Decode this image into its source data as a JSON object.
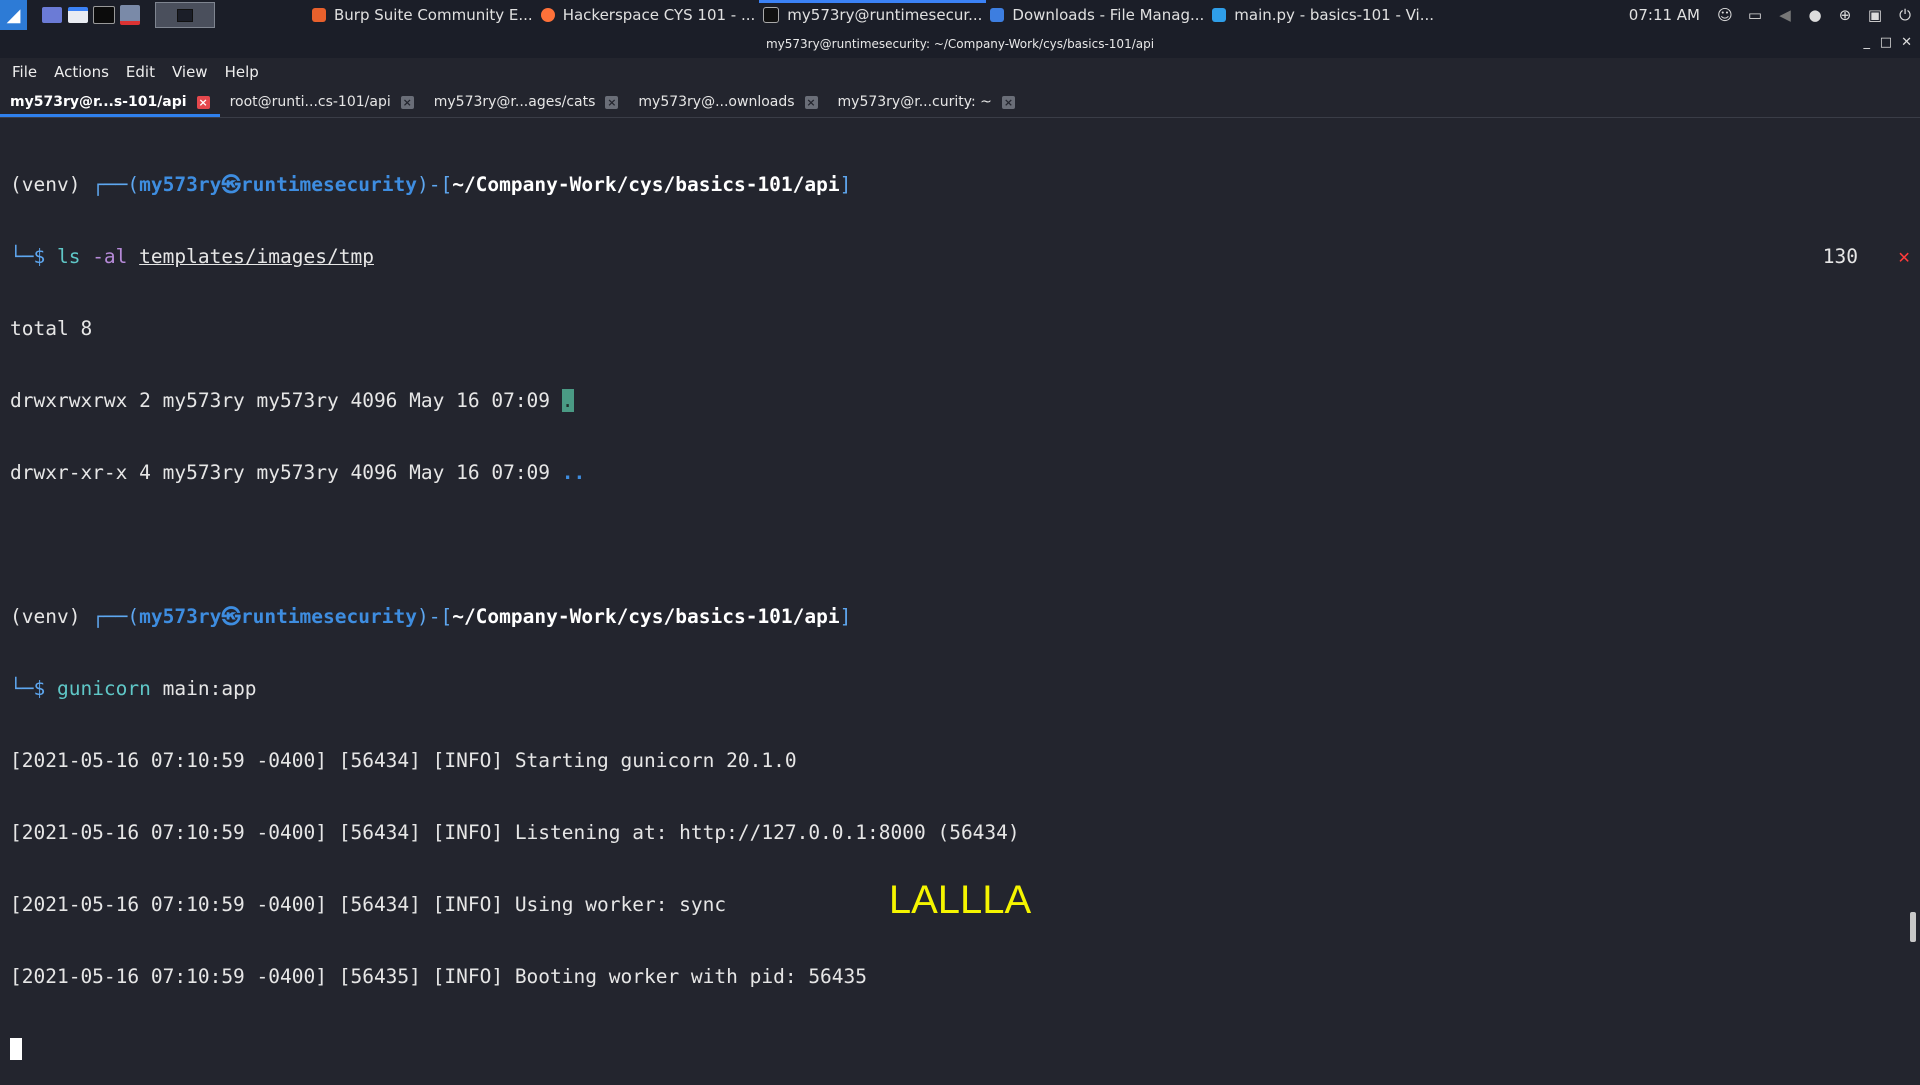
{
  "taskbar": {
    "tasks": [
      {
        "label": "Burp Suite Community E...",
        "icon": "burp-icon",
        "color": "#e8602c"
      },
      {
        "label": "Hackerspace CYS 101 - ...",
        "icon": "firefox-icon",
        "color": "#ff7139"
      },
      {
        "label": "my573ry@runtimesecur...",
        "icon": "terminal-icon",
        "color": "#111111"
      },
      {
        "label": "Downloads - File Manag...",
        "icon": "folder-icon",
        "color": "#3d7ee0"
      },
      {
        "label": "main.py - basics-101 - Vi...",
        "icon": "vscode-icon",
        "color": "#2f9ee8"
      }
    ],
    "clock": "07:11 AM"
  },
  "window": {
    "title": "my573ry@runtimesecurity: ~/Company-Work/cys/basics-101/api",
    "menu": [
      "File",
      "Actions",
      "Edit",
      "View",
      "Help"
    ],
    "tabs": [
      {
        "label": "my573ry@r...s-101/api",
        "active": true
      },
      {
        "label": "root@runti...cs-101/api",
        "active": false
      },
      {
        "label": "my573ry@r...ages/cats",
        "active": false
      },
      {
        "label": "my573ry@...ownloads",
        "active": false
      },
      {
        "label": "my573ry@r...curity: ~",
        "active": false
      }
    ]
  },
  "terminal": {
    "prompt1": {
      "venv": "(venv) ",
      "corner": "┌──(",
      "user": "my573ry",
      "sep": "㉿",
      "host": "runtimesecurity",
      "mid": ")-[",
      "path": "~/Company-Work/cys/basics-101/api",
      "close": "]",
      "arrow": "└─$ ",
      "cmd": "ls",
      "opt": " -al ",
      "arg": "templates/images/tmp",
      "exit_code": "130",
      "exit_mark": "✕"
    },
    "ls_output": {
      "total": "total 8",
      "row1": "drwxrwxrwx 2 my573ry my573ry 4096 May 16 07:09 ",
      "row1_name": ".",
      "row2": "drwxr-xr-x 4 my573ry my573ry 4096 May 16 07:09 ",
      "row2_name": ".."
    },
    "prompt2": {
      "venv": "(venv) ",
      "corner": "┌──(",
      "user": "my573ry",
      "sep": "㉿",
      "host": "runtimesecurity",
      "mid": ")-[",
      "path": "~/Company-Work/cys/basics-101/api",
      "close": "]",
      "arrow": "└─$ ",
      "cmd": "gunicorn",
      "arg": " main:app"
    },
    "log": [
      "[2021-05-16 07:10:59 -0400] [56434] [INFO] Starting gunicorn 20.1.0",
      "[2021-05-16 07:10:59 -0400] [56434] [INFO] Listening at: http://127.0.0.1:8000 (56434)",
      "[2021-05-16 07:10:59 -0400] [56434] [INFO] Using worker: sync",
      "[2021-05-16 07:10:59 -0400] [56435] [INFO] Booting worker with pid: 56435"
    ]
  },
  "overlay_text": "LALLLA"
}
